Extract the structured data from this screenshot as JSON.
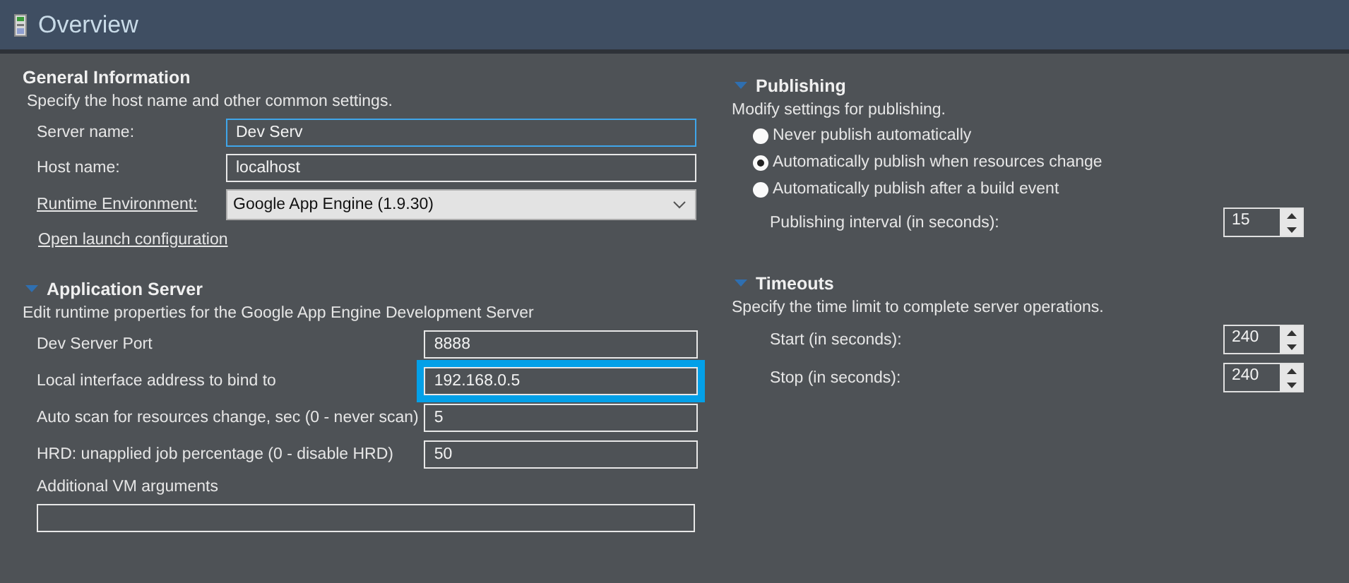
{
  "header": {
    "title": "Overview"
  },
  "general": {
    "title": "General Information",
    "description": "Specify the host name and other common settings.",
    "fields": [
      {
        "kind": "text",
        "label": "Server name:",
        "value": "Dev Serv",
        "focused": true
      },
      {
        "kind": "text",
        "label": "Host name:",
        "value": "localhost",
        "focused": false
      },
      {
        "kind": "dropdown",
        "label": "Runtime Environment:",
        "value": "Google App Engine (1.9.30)",
        "focused": false
      }
    ],
    "link": "Open launch configuration"
  },
  "app_server": {
    "title": "Application Server",
    "expanded": true,
    "description": "Edit runtime properties for the Google App Engine Development Server",
    "fields": [
      {
        "label": "Dev Server Port",
        "value": "8888",
        "highlighted": false
      },
      {
        "label": "Local interface address to bind to",
        "value": "192.168.0.5",
        "highlighted": true
      },
      {
        "label": "Auto scan for resources change, sec (0 - never scan)",
        "value": "5",
        "highlighted": false
      },
      {
        "label": "HRD: unapplied job percentage (0 - disable HRD)",
        "value": "50",
        "highlighted": false
      }
    ],
    "extra_label": "Additional VM arguments"
  },
  "publishing": {
    "title": "Publishing",
    "expanded": true,
    "description": "Modify settings for publishing.",
    "options": [
      {
        "label": "Never publish automatically",
        "selected": false
      },
      {
        "label": "Automatically publish when resources change",
        "selected": true
      },
      {
        "label": "Automatically publish after a build event",
        "selected": false
      }
    ],
    "interval": {
      "label": "Publishing interval (in seconds):",
      "value": "15"
    }
  },
  "timeouts": {
    "title": "Timeouts",
    "expanded": true,
    "description": "Specify the time limit to complete server operations.",
    "fields": [
      {
        "label": "Start (in seconds):",
        "value": "240"
      },
      {
        "label": "Stop (in seconds):",
        "value": "240"
      }
    ]
  }
}
